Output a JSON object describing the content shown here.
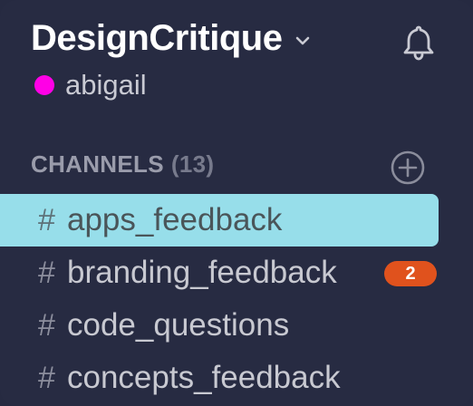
{
  "workspace": {
    "team_name": "DesignCritique",
    "chevron_icon": "chevron-down-icon",
    "notifications_icon": "bell-icon"
  },
  "user": {
    "name": "abigail",
    "presence_color": "#ff00e6"
  },
  "channels_section": {
    "label": "CHANNELS",
    "count": "(13)",
    "add_icon": "plus-circle-icon"
  },
  "channels": [
    {
      "hash": "#",
      "name": "apps_feedback",
      "active": true,
      "badge": null
    },
    {
      "hash": "#",
      "name": "branding_feedback",
      "active": false,
      "badge": "2"
    },
    {
      "hash": "#",
      "name": "code_questions",
      "active": false,
      "badge": null
    },
    {
      "hash": "#",
      "name": "concepts_feedback",
      "active": false,
      "badge": null
    }
  ],
  "colors": {
    "sidebar_bg": "#272b42",
    "active_channel_bg": "#97deea",
    "badge_bg": "#e0521d",
    "presence": "#ff00e6"
  }
}
